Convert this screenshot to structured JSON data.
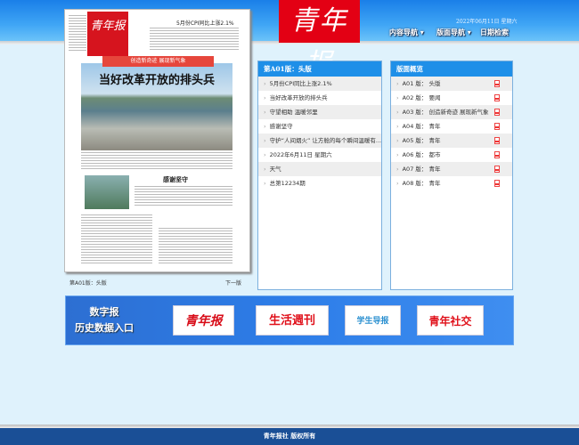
{
  "header": {
    "logo": "青年报",
    "date": "2022年06月11日 星期六",
    "nav": [
      "内容导航",
      "版面导航",
      "日期检索"
    ]
  },
  "paper": {
    "headline": "当好改革开放的排头兵",
    "top_story": "5月份CPI同比上涨2.1%",
    "banner": "创造新奇迹 展现新气象",
    "section_title": "感谢坚守",
    "label": "第A01版：头版",
    "next": "下一版"
  },
  "articles": {
    "title": "第A01版：头版",
    "items": [
      "5月份CPI同比上涨2.1%",
      "当好改革开放的排头兵",
      "守望相助 温暖邻里",
      "感谢坚守",
      "守护“人间烟火” 让方舱的每个瞬间温暖有...",
      "2022年6月11日 星期六",
      "天气",
      "总第12234期"
    ]
  },
  "pages": {
    "title": "版面概览",
    "items": [
      "A01 版：  头版",
      "A02 版：  要闻",
      "A03 版：  创造新奇迹 展现新气象",
      "A04 版：  青年",
      "A05 版：  青年",
      "A06 版：  都市",
      "A07 版：  青年",
      "A08 版：  青年"
    ]
  },
  "banner": {
    "line1": "数字报",
    "line2": "历史数据入口",
    "logos": [
      "青年报",
      "生活週刊",
      "学生导报",
      "青年社交"
    ]
  },
  "footer": "青年报社  版权所有"
}
